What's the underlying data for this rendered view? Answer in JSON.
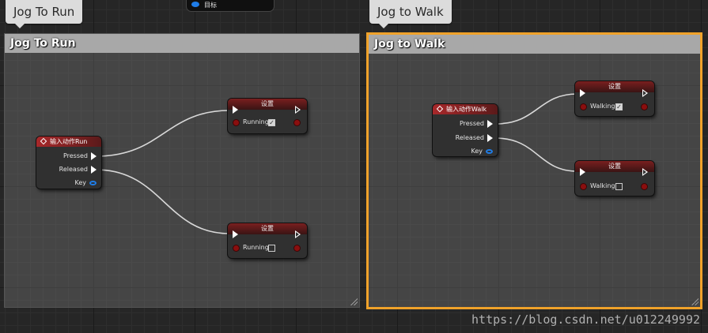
{
  "top_node": {
    "label": "目标",
    "icon": "object-pin-icon"
  },
  "comments": [
    {
      "bubble": "Jog To Run",
      "title": "Jog To Run"
    },
    {
      "bubble": "Jog to Walk",
      "title": "Jog to Walk"
    }
  ],
  "run": {
    "event": {
      "title": "输入动作Run",
      "pressed": "Pressed",
      "released": "Released",
      "key": "Key"
    },
    "set_pressed": {
      "title": "设置",
      "var": "Running",
      "checked": "✓"
    },
    "set_released": {
      "title": "设置",
      "var": "Running",
      "checked": ""
    }
  },
  "walk": {
    "event": {
      "title": "输入动作Walk",
      "pressed": "Pressed",
      "released": "Released",
      "key": "Key"
    },
    "set_pressed": {
      "title": "设置",
      "var": "Walking",
      "checked": "✓"
    },
    "set_released": {
      "title": "设置",
      "var": "Walking",
      "checked": ""
    }
  },
  "colors": {
    "selected_border": "#f0a22a",
    "event_header": "#a8282a",
    "bool_pin": "#8a0f0f",
    "struct_pin": "#1f7de8"
  },
  "watermark": "https://blog.csdn.net/u012249992"
}
